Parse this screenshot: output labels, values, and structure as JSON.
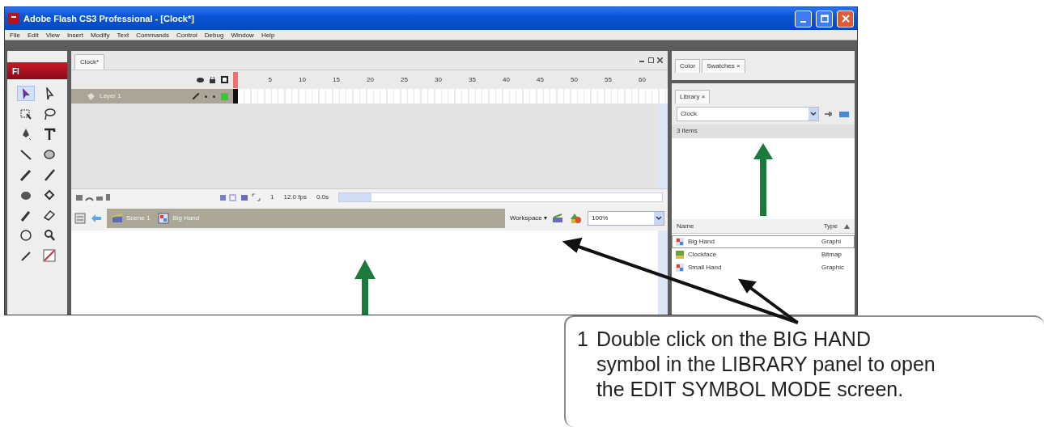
{
  "window": {
    "title": "Adobe Flash CS3 Professional - [Clock*]"
  },
  "menu": [
    "File",
    "Edit",
    "View",
    "Insert",
    "Modify",
    "Text",
    "Commands",
    "Control",
    "Debug",
    "Window",
    "Help"
  ],
  "toolbar": {
    "logo": "Fl",
    "tools": [
      {
        "selected": true
      },
      {
        "selected": false
      },
      {
        "selected": false
      },
      {
        "selected": false
      },
      {
        "selected": false
      },
      {
        "selected": false
      },
      {
        "selected": false
      },
      {
        "selected": false
      },
      {
        "selected": false
      },
      {
        "selected": false
      },
      {
        "selected": false
      },
      {
        "selected": false
      },
      {
        "selected": false
      },
      {
        "selected": false
      },
      {
        "selected": false
      },
      {
        "selected": false
      },
      {
        "selected": false
      },
      {
        "selected": false
      }
    ]
  },
  "document": {
    "tab": "Clock*",
    "timeline": {
      "frame_numbers": [
        "5",
        "10",
        "15",
        "20",
        "25",
        "30",
        "35",
        "40",
        "45",
        "50",
        "55",
        "60"
      ],
      "layers": [
        {
          "name": "Layer 1",
          "selected": true
        }
      ],
      "current_frame": "1",
      "frame_rate": "12.0 fps",
      "elapsed_time": "0.0s"
    },
    "edit_bar": {
      "breadcrumbs": [
        "Scene 1",
        "Big Hand"
      ],
      "workspace": "Workspace ▾",
      "zoom": "100%"
    }
  },
  "panels": {
    "tabs": [
      {
        "label": "Color"
      },
      {
        "label": "Swatches",
        "close": "×"
      }
    ]
  },
  "library": {
    "tab": "Library",
    "close": "×",
    "source": "Clock",
    "count": "3 items",
    "columns": [
      "Name",
      "Type"
    ],
    "items": [
      {
        "name": "Big Hand",
        "type": "Graphi",
        "selected": true,
        "kind": "graphic"
      },
      {
        "name": "Clockface",
        "type": "Bitmap",
        "selected": false,
        "kind": "bitmap"
      },
      {
        "name": "Small Hand",
        "type": "Graphic",
        "selected": false,
        "kind": "graphic"
      }
    ]
  },
  "callout": {
    "step": "1",
    "text": "Double click on the BIG HAND\nsymbol in the LIBRARY panel to open\nthe EDIT SYMBOL MODE screen."
  }
}
